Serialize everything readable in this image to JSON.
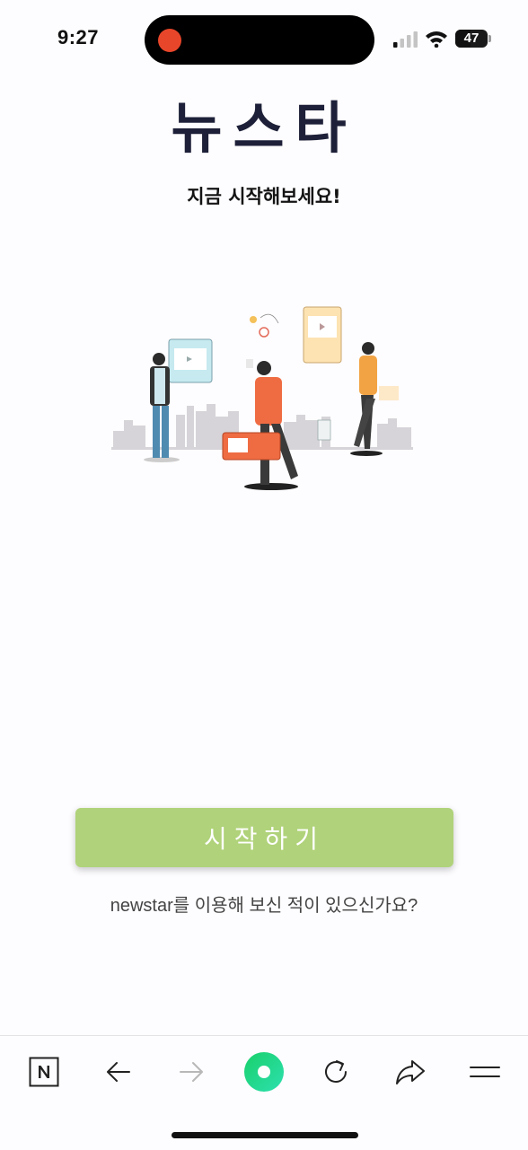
{
  "status_bar": {
    "time": "9:27",
    "battery": "47",
    "battery_level": 0.47,
    "recording_color": "#e8462a"
  },
  "header": {
    "title": "뉴스타",
    "subtitle": "지금 시작해보세요!"
  },
  "illustration": {
    "name": "people-using-phones-illustration"
  },
  "actions": {
    "start_label": "시작하기",
    "login_prompt": "newstar를 이용해 보신 적이 있으신가요?"
  },
  "toolbar": {
    "items": [
      "naver-home-icon",
      "back-arrow-icon",
      "forward-arrow-icon",
      "green-dot-icon",
      "refresh-icon",
      "share-icon",
      "menu-icon"
    ]
  },
  "colors": {
    "accent": "#b0d27a",
    "title": "#1d2038",
    "green_dot": "#1fd37a"
  }
}
